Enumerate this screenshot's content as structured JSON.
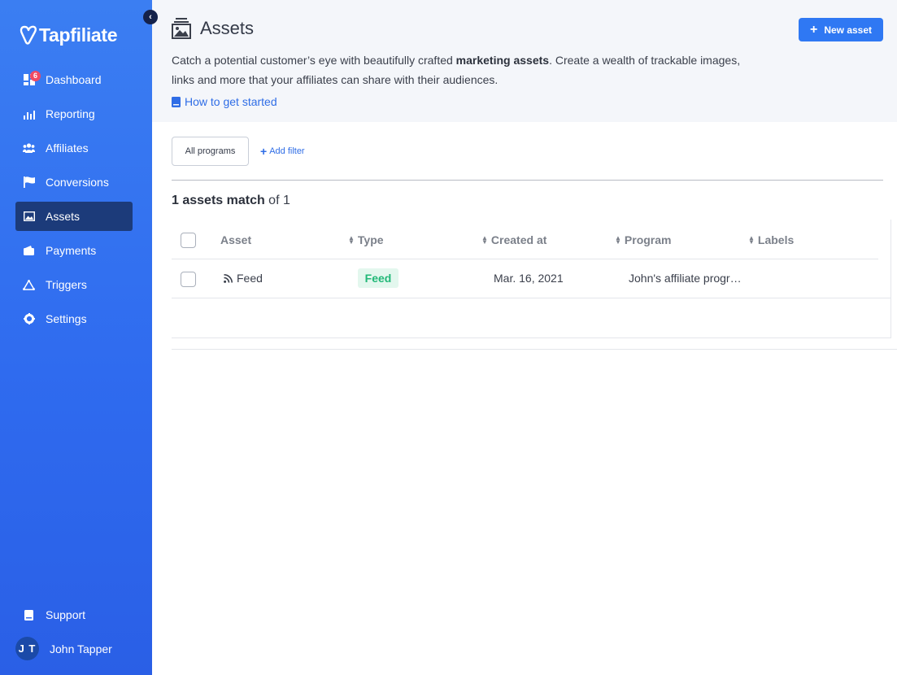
{
  "app": {
    "logo_text": "Tapfiliate",
    "collapse_icon": "chevron-left-icon"
  },
  "sidebar": {
    "items": [
      {
        "label": "Dashboard",
        "icon": "dashboard-icon",
        "badge": "6"
      },
      {
        "label": "Reporting",
        "icon": "bar-chart-icon"
      },
      {
        "label": "Affiliates",
        "icon": "users-icon"
      },
      {
        "label": "Conversions",
        "icon": "flag-icon"
      },
      {
        "label": "Assets",
        "icon": "image-icon",
        "active": true
      },
      {
        "label": "Payments",
        "icon": "wallet-icon"
      },
      {
        "label": "Triggers",
        "icon": "triangle-icon"
      },
      {
        "label": "Settings",
        "icon": "gear-icon"
      }
    ],
    "support_label": "Support",
    "user": {
      "initials": "J T",
      "name": "John Tapper"
    }
  },
  "header": {
    "title": "Assets",
    "new_asset_label": "New asset",
    "intro_before": "Catch a potential customer’s eye with beautifully crafted ",
    "intro_bold": "marketing assets",
    "intro_after": ". Create a wealth of trackable images, links and more that your affiliates can share with their audiences.",
    "howto_label": "How to get started"
  },
  "filters": {
    "program_label": "All programs",
    "add_filter_label": "Add filter"
  },
  "results": {
    "match_bold": "1 assets match",
    "match_rest": " of 1"
  },
  "table": {
    "columns": [
      "Asset",
      "Type",
      "Created at",
      "Program",
      "Labels"
    ],
    "rows": [
      {
        "asset": "Feed",
        "type": "Feed",
        "created_at": "Mar. 16, 2021",
        "program": "John's affiliate progr…",
        "labels": ""
      }
    ]
  },
  "colors": {
    "sidebar": "#2f6bef",
    "active_nav": "#1c3b7a",
    "accent": "#2f78f3",
    "feed_badge_bg": "#e3f7ee",
    "feed_badge_text": "#22b878",
    "badge_red": "#f04a63"
  }
}
